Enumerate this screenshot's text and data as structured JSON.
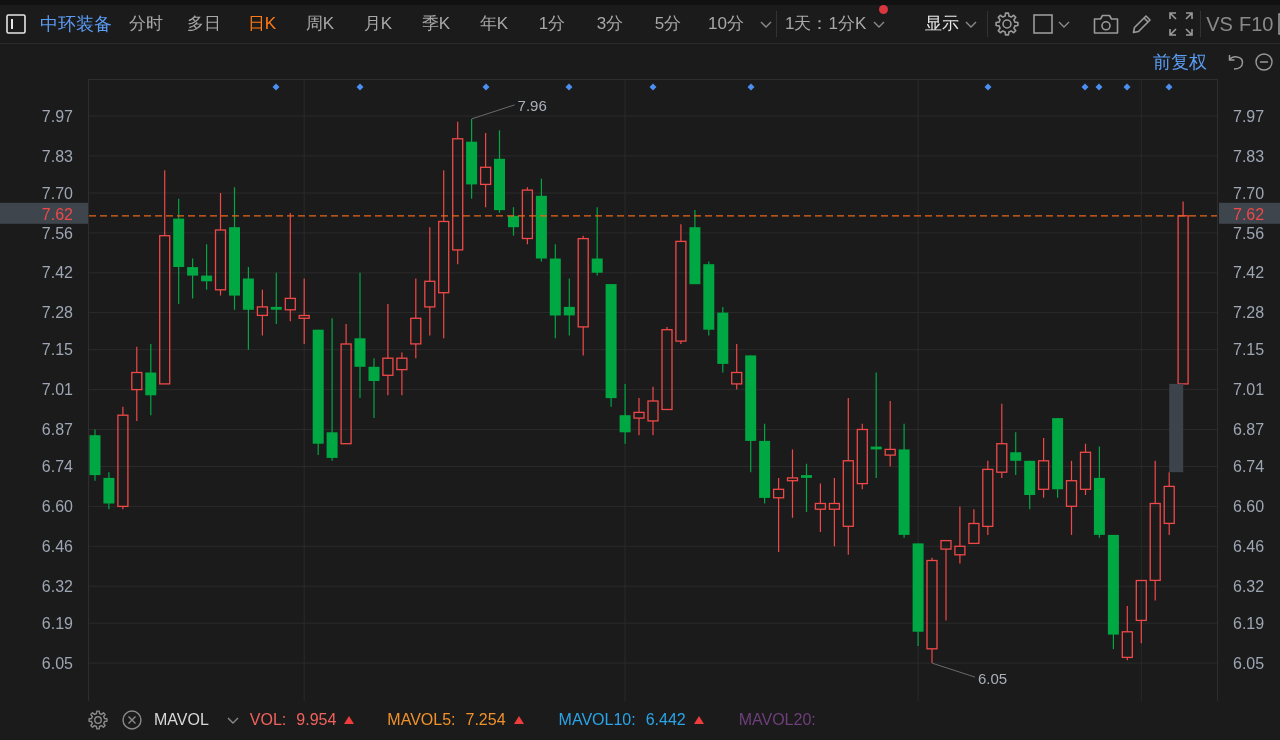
{
  "toolbar": {
    "stock_name": "中环装备",
    "periods": [
      {
        "label": "分时",
        "selected": false
      },
      {
        "label": "多日",
        "selected": false
      },
      {
        "label": "日K",
        "selected": true
      },
      {
        "label": "周K",
        "selected": false
      },
      {
        "label": "月K",
        "selected": false
      },
      {
        "label": "季K",
        "selected": false
      },
      {
        "label": "年K",
        "selected": false
      },
      {
        "label": "1分",
        "selected": false
      },
      {
        "label": "3分",
        "selected": false
      },
      {
        "label": "5分",
        "selected": false
      },
      {
        "label": "10分",
        "selected": false
      }
    ],
    "interval": {
      "label": "1天：1分K",
      "unread": true
    },
    "display": "显示",
    "compare": "VS",
    "f10": "F10"
  },
  "chart_header": {
    "adjustment": "前复权"
  },
  "price_chart": {
    "right_axis": [
      "7.97",
      "7.83",
      "7.70",
      "7.56",
      "7.42",
      "7.28",
      "7.15",
      "7.01",
      "6.87",
      "6.74",
      "6.60",
      "6.46",
      "6.32",
      "6.19",
      "6.05"
    ],
    "last_price": {
      "left_tag": "7.62",
      "right_tag": "7.62"
    },
    "high_label": "7.96",
    "low_label": "6.05",
    "chart_data": {
      "type": "candlestick",
      "grid": true,
      "categories": [
        null,
        null,
        null,
        null,
        null,
        null,
        null,
        null,
        null,
        null,
        null,
        null,
        null,
        null,
        null,
        null,
        null,
        null,
        null,
        null,
        null,
        null,
        null,
        null,
        null,
        null,
        null,
        null,
        null,
        null,
        null,
        null,
        null,
        null,
        null,
        null,
        null,
        null,
        null,
        null,
        null,
        null,
        null,
        null,
        null,
        null,
        null,
        null,
        null,
        null,
        null,
        null,
        null,
        null,
        null,
        null,
        null,
        null,
        null,
        null,
        null,
        null,
        null,
        null,
        null,
        null,
        null,
        null,
        null,
        null,
        null,
        null,
        null,
        null,
        null,
        null,
        null,
        null,
        null,
        null,
        null
      ],
      "ylim": [
        5.917,
        8.1
      ],
      "yticks": [
        7.97,
        7.83,
        {
          "value": 7.7,
          "label": "7.70"
        },
        7.56,
        7.42,
        7.28,
        7.15,
        7.01,
        6.87,
        6.74,
        {
          "value": 6.6,
          "label": "6.60"
        },
        6.46,
        6.32,
        6.19,
        6.05
      ],
      "ohlc": [
        [
          6.85,
          6.87,
          6.69,
          6.71
        ],
        [
          6.7,
          6.72,
          6.59,
          6.61
        ],
        [
          6.6,
          6.95,
          6.59,
          6.92
        ],
        [
          7.01,
          7.16,
          6.9,
          7.07
        ],
        [
          7.07,
          7.17,
          6.92,
          6.99
        ],
        [
          7.03,
          7.78,
          7.03,
          7.55
        ],
        [
          7.61,
          7.68,
          7.31,
          7.44
        ],
        [
          7.44,
          7.47,
          7.33,
          7.41
        ],
        [
          7.41,
          7.52,
          7.36,
          7.39
        ],
        [
          7.36,
          7.7,
          7.34,
          7.57
        ],
        [
          7.58,
          7.72,
          7.29,
          7.34
        ],
        [
          7.4,
          7.44,
          7.15,
          7.29
        ],
        [
          7.27,
          7.36,
          7.2,
          7.3
        ],
        [
          7.3,
          7.42,
          7.24,
          7.29
        ],
        [
          7.29,
          7.63,
          7.25,
          7.33
        ],
        [
          7.26,
          7.4,
          7.17,
          7.27
        ],
        [
          7.22,
          7.22,
          6.78,
          6.82
        ],
        [
          6.86,
          7.26,
          6.76,
          6.77
        ],
        [
          6.82,
          7.24,
          6.82,
          7.17
        ],
        [
          7.19,
          7.42,
          6.98,
          7.09
        ],
        [
          7.09,
          7.12,
          6.91,
          7.04
        ],
        [
          7.06,
          7.31,
          6.99,
          7.12
        ],
        [
          7.08,
          7.14,
          6.99,
          7.12
        ],
        [
          7.17,
          7.4,
          7.12,
          7.26
        ],
        [
          7.3,
          7.58,
          7.2,
          7.39
        ],
        [
          7.35,
          7.78,
          7.19,
          7.6
        ],
        [
          7.5,
          7.95,
          7.45,
          7.89
        ],
        [
          7.88,
          7.96,
          7.68,
          7.73
        ],
        [
          7.73,
          7.91,
          7.65,
          7.79
        ],
        [
          7.82,
          7.92,
          7.63,
          7.64
        ],
        [
          7.62,
          7.65,
          7.55,
          7.58
        ],
        [
          7.54,
          7.72,
          7.52,
          7.71
        ],
        [
          7.69,
          7.75,
          7.46,
          7.47
        ],
        [
          7.47,
          7.52,
          7.19,
          7.27
        ],
        [
          7.3,
          7.4,
          7.2,
          7.27
        ],
        [
          7.23,
          7.55,
          7.13,
          7.54
        ],
        [
          7.47,
          7.65,
          7.41,
          7.42
        ],
        [
          7.38,
          7.38,
          6.95,
          6.98
        ],
        [
          6.92,
          7.03,
          6.82,
          6.86
        ],
        [
          6.91,
          6.98,
          6.85,
          6.93
        ],
        [
          6.9,
          7.02,
          6.85,
          6.97
        ],
        [
          6.94,
          7.23,
          6.94,
          7.22
        ],
        [
          7.18,
          7.59,
          7.17,
          7.53
        ],
        [
          7.58,
          7.64,
          7.38,
          7.38
        ],
        [
          7.45,
          7.46,
          7.2,
          7.22
        ],
        [
          7.28,
          7.3,
          7.07,
          7.1
        ],
        [
          7.03,
          7.17,
          7.01,
          7.07
        ],
        [
          7.13,
          7.13,
          6.72,
          6.83
        ],
        [
          6.83,
          6.89,
          6.61,
          6.63
        ],
        [
          6.63,
          6.7,
          6.44,
          6.66
        ],
        [
          6.69,
          6.8,
          6.56,
          6.7
        ],
        [
          6.71,
          6.75,
          6.58,
          6.7
        ],
        [
          6.59,
          6.68,
          6.51,
          6.61
        ],
        [
          6.59,
          6.7,
          6.46,
          6.61
        ],
        [
          6.53,
          6.98,
          6.43,
          6.76
        ],
        [
          6.68,
          6.89,
          6.66,
          6.87
        ],
        [
          6.81,
          7.07,
          6.7,
          6.8
        ],
        [
          6.78,
          6.97,
          6.74,
          6.8
        ],
        [
          6.8,
          6.89,
          6.49,
          6.5
        ],
        [
          6.47,
          6.47,
          6.11,
          6.16
        ],
        [
          6.1,
          6.42,
          6.05,
          6.41
        ],
        [
          6.45,
          6.48,
          6.2,
          6.48
        ],
        [
          6.43,
          6.6,
          6.4,
          6.46
        ],
        [
          6.47,
          6.59,
          6.47,
          6.54
        ],
        [
          6.53,
          6.76,
          6.5,
          6.73
        ],
        [
          6.72,
          6.96,
          6.7,
          6.82
        ],
        [
          6.79,
          6.86,
          6.71,
          6.76
        ],
        [
          6.76,
          6.76,
          6.59,
          6.64
        ],
        [
          6.66,
          6.84,
          6.63,
          6.76
        ],
        [
          6.91,
          6.91,
          6.63,
          6.66
        ],
        [
          6.6,
          6.76,
          6.5,
          6.69
        ],
        [
          6.66,
          6.82,
          6.64,
          6.79
        ],
        [
          6.7,
          6.81,
          6.49,
          6.5
        ],
        [
          6.5,
          6.5,
          6.1,
          6.15
        ],
        [
          6.07,
          6.25,
          6.06,
          6.16
        ],
        [
          6.2,
          6.34,
          6.12,
          6.34
        ],
        [
          6.34,
          6.76,
          6.27,
          6.61
        ],
        [
          6.54,
          6.72,
          6.5,
          6.67
        ],
        [
          7.03,
          7.67,
          7.03,
          7.62
        ],
        null,
        null
      ]
    }
  },
  "indicator_bar": {
    "selector": "MAVOL",
    "items": [
      {
        "label": "VOL:",
        "value": "9.954",
        "rising": true,
        "color": "#f2625c"
      },
      {
        "label": "MAVOL5:",
        "value": "7.254",
        "rising": true,
        "color": "#f0922b"
      },
      {
        "label": "MAVOL10:",
        "value": "6.442",
        "rising": true,
        "color": "#2aa4e8"
      },
      {
        "label": "MAVOL20:",
        "color": "#6e3f7c"
      }
    ]
  }
}
